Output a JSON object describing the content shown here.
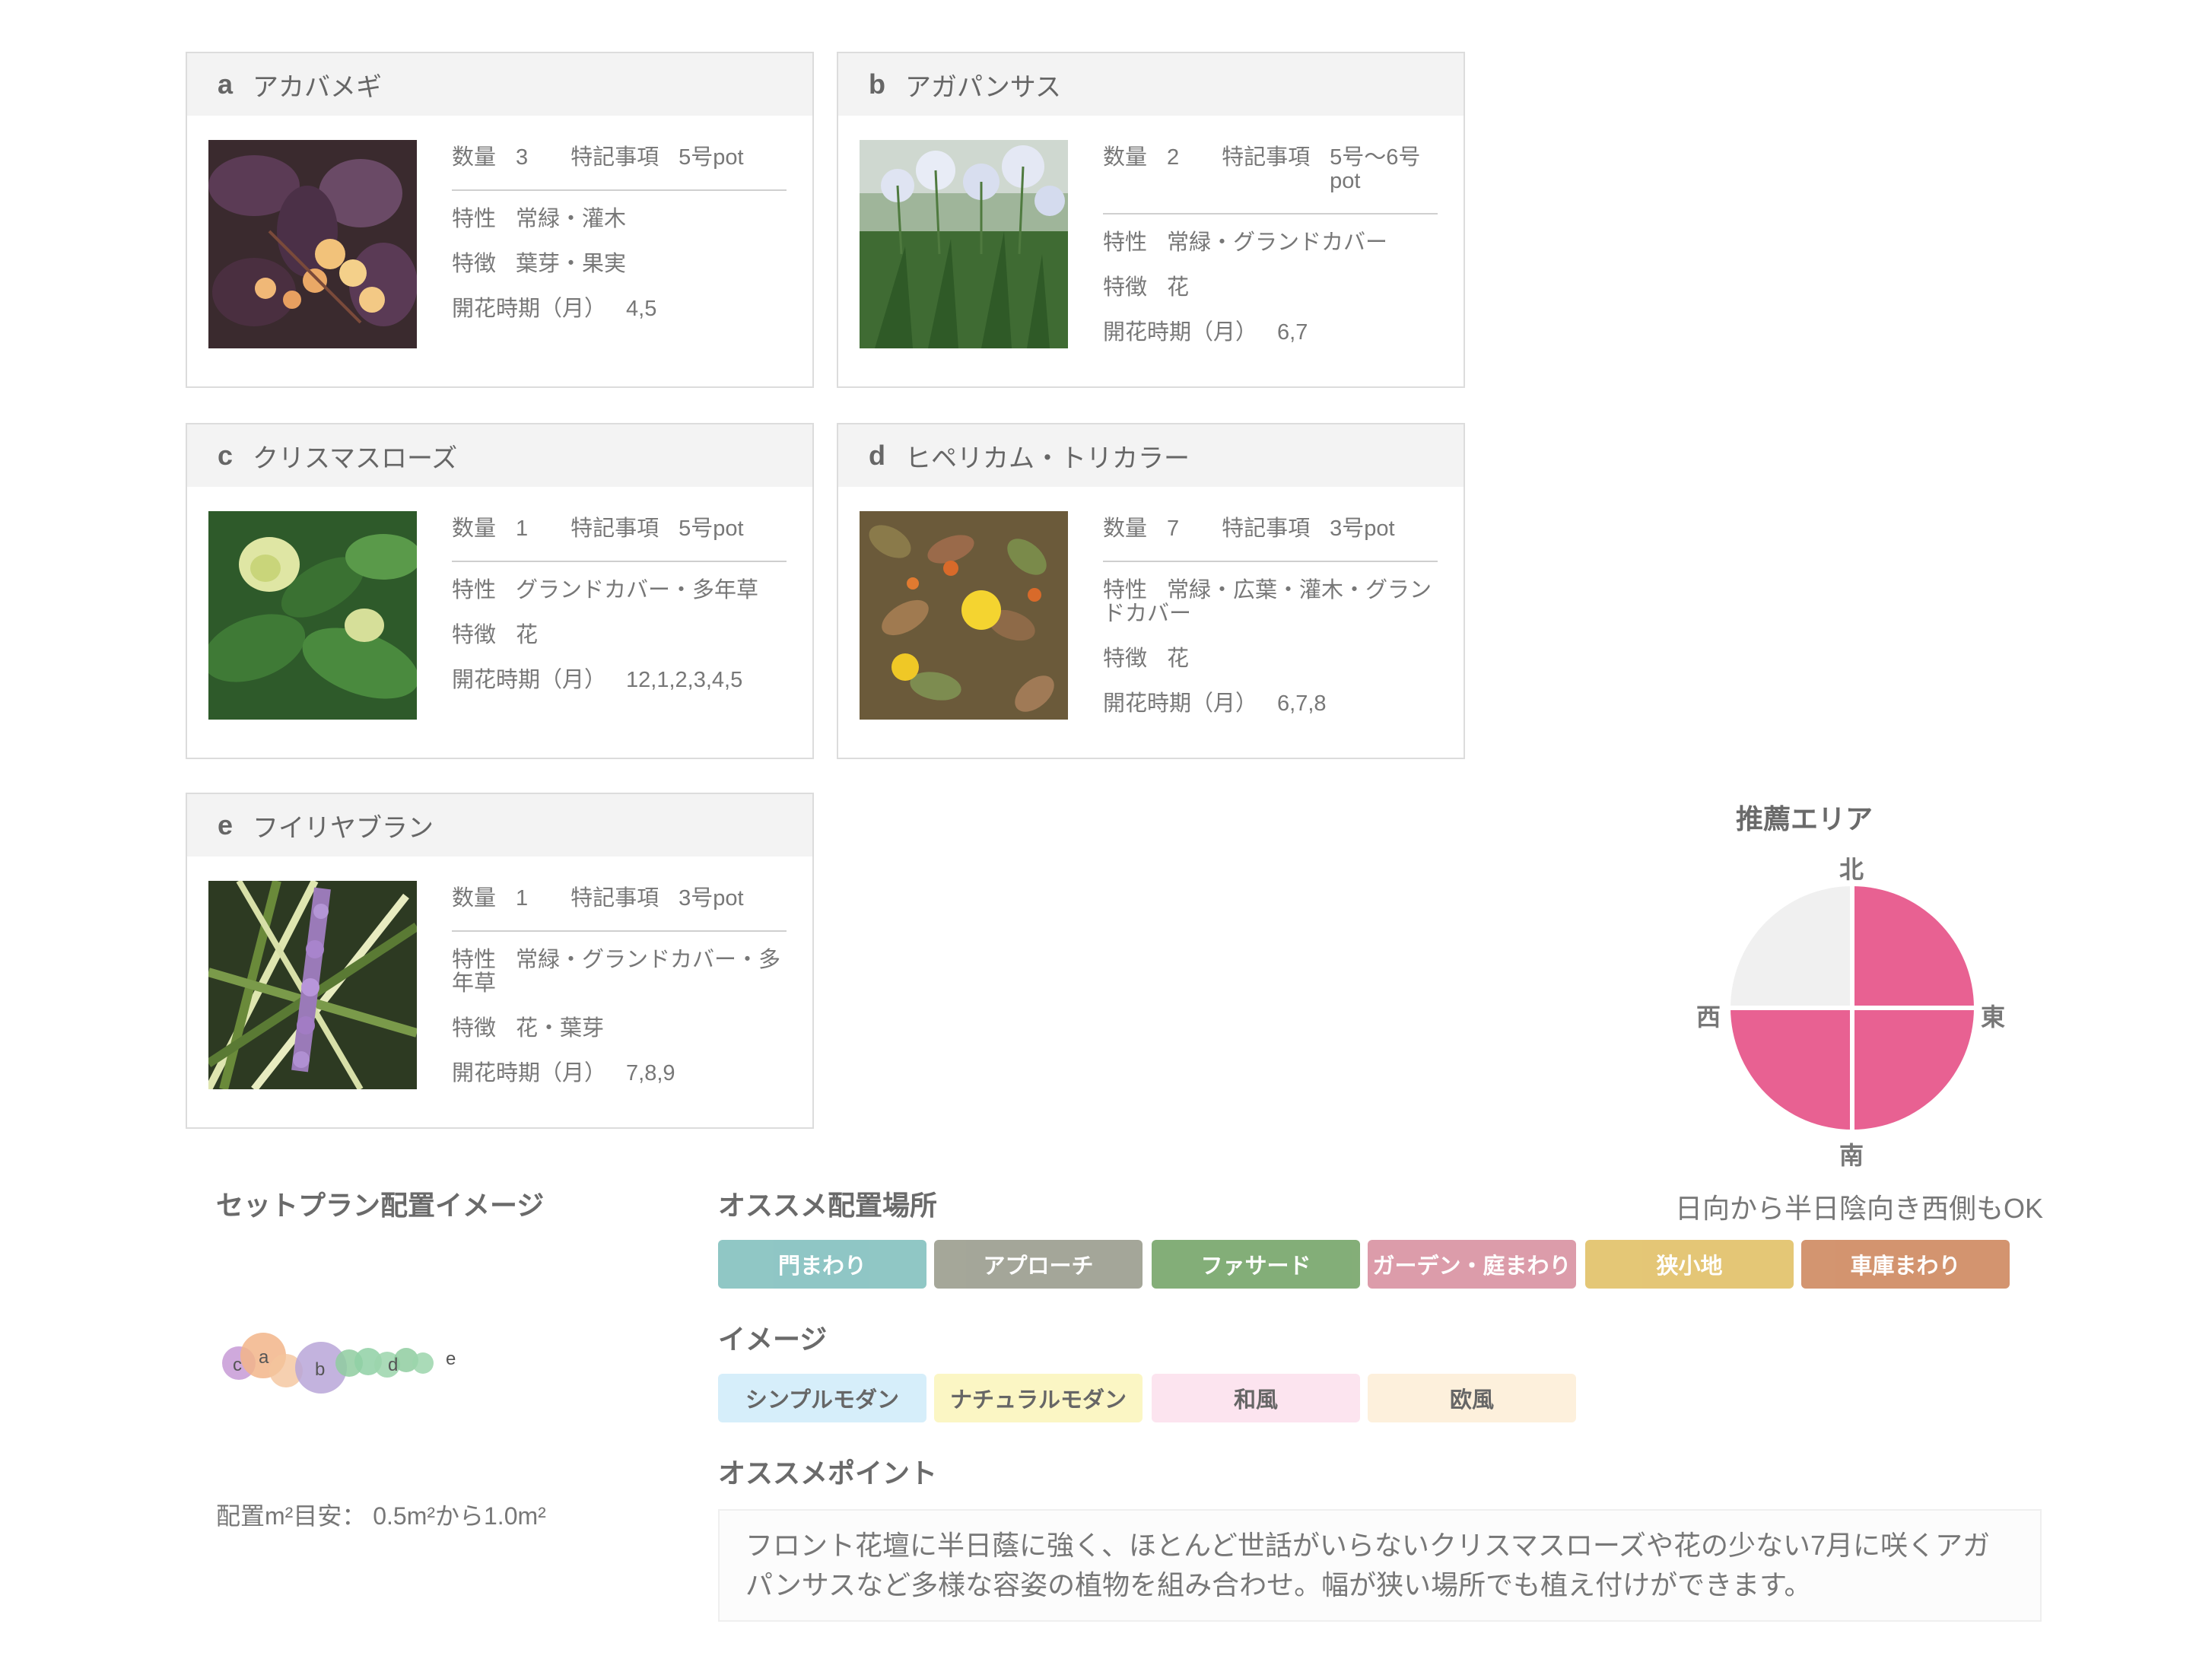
{
  "plants": [
    {
      "letter": "a",
      "name": "アカバメギ",
      "qty_label": "数量",
      "qty": "3",
      "note_label": "特記事項",
      "note": "5号pot",
      "trait_label": "特性",
      "trait": "常緑・灌木",
      "feature_label": "特徴",
      "feature": "葉芽・果実",
      "bloom_label": "開花時期（月）",
      "bloom": "4,5"
    },
    {
      "letter": "b",
      "name": "アガパンサス",
      "qty_label": "数量",
      "qty": "2",
      "note_label": "特記事項",
      "note": "5号〜6号pot",
      "trait_label": "特性",
      "trait": "常緑・グランドカバー",
      "feature_label": "特徴",
      "feature": "花",
      "bloom_label": "開花時期（月）",
      "bloom": "6,7"
    },
    {
      "letter": "c",
      "name": "クリスマスローズ",
      "qty_label": "数量",
      "qty": "1",
      "note_label": "特記事項",
      "note": "5号pot",
      "trait_label": "特性",
      "trait": "グランドカバー・多年草",
      "feature_label": "特徴",
      "feature": "花",
      "bloom_label": "開花時期（月）",
      "bloom": "12,1,2,3,4,5"
    },
    {
      "letter": "d",
      "name": "ヒペリカム・トリカラー",
      "qty_label": "数量",
      "qty": "7",
      "note_label": "特記事項",
      "note": "3号pot",
      "trait_label": "特性",
      "trait": "常緑・広葉・灌木・グランドカバー",
      "feature_label": "特徴",
      "feature": "花",
      "bloom_label": "開花時期（月）",
      "bloom": "6,7,8"
    },
    {
      "letter": "e",
      "name": "フイリヤブラン",
      "qty_label": "数量",
      "qty": "1",
      "note_label": "特記事項",
      "note": "3号pot",
      "trait_label": "特性",
      "trait": "常緑・グランドカバー・多年草",
      "feature_label": "特徴",
      "feature": "花・葉芽",
      "bloom_label": "開花時期（月）",
      "bloom": "7,8,9"
    }
  ],
  "area": {
    "title": "推薦エリア",
    "north": "北",
    "east": "東",
    "south": "南",
    "west": "西",
    "note": "日向から半日陰向き西側もOK",
    "active_color": "#e86192",
    "inactive_color": "#f0f0f0",
    "quadrants": {
      "north_east": true,
      "north_west": false,
      "south_east": true,
      "south_west": true
    }
  },
  "layout_plan": {
    "title": "セットプラン配置イメージ",
    "labels": [
      "c",
      "a",
      "b",
      "d",
      "e"
    ],
    "area_text": "配置m²目安： 0.5m²から1.0m²"
  },
  "places": {
    "title": "オススメ配置場所",
    "items": [
      {
        "label": "門まわり",
        "color": "#8ac4c2"
      },
      {
        "label": "アプローチ",
        "color": "#a0a294"
      },
      {
        "label": "ファサード",
        "color": "#7daa71"
      },
      {
        "label": "ガーデン・庭まわり",
        "color": "#db97a6"
      },
      {
        "label": "狭小地",
        "color": "#e3c46f"
      },
      {
        "label": "車庫まわり",
        "color": "#d18f68"
      }
    ]
  },
  "image_tags": {
    "title": "イメージ",
    "items": [
      {
        "label": "シンプルモダン",
        "color": "#d6eefa"
      },
      {
        "label": "ナチュラルモダン",
        "color": "#fbf6c4"
      },
      {
        "label": "和風",
        "color": "#fce4ef"
      },
      {
        "label": "欧風",
        "color": "#fdf0dc"
      }
    ]
  },
  "point": {
    "title": "オススメポイント",
    "text": "フロント花壇に半日蔭に強く、ほとんど世話がいらないクリスマスローズや花の少ない7月に咲くアガパンサスなど多様な容姿の植物を組み合わせ。幅が狭い場所でも植え付けができます。"
  }
}
